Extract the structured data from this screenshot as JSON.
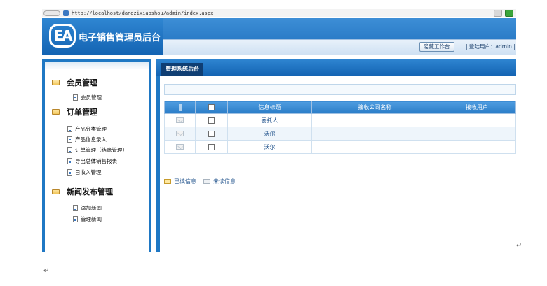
{
  "browser": {
    "url": "http://localhost/dаndzixiaoshou/admin/index.aspx"
  },
  "header": {
    "logo_mark": "EA",
    "title": "电子销售管理员后台",
    "hide_workbench_label": "隐藏工作台",
    "login_info": "| 登陆用户：admin |"
  },
  "sidebar": {
    "groups": [
      {
        "title": "会员管理",
        "items": [
          "会员管理"
        ]
      },
      {
        "title": "订单管理",
        "items": [
          "产品分类管理",
          "产品信息录入",
          "订单管理（结账管理）",
          "导出总体销售报表",
          "日收入管理"
        ]
      },
      {
        "title": "新闻发布管理",
        "items": [
          "添加新闻",
          "管理新闻"
        ]
      }
    ]
  },
  "main": {
    "tab_label": "管理系统后台",
    "table": {
      "headers": [
        "",
        "",
        "信息标题",
        "接收公司名称",
        "接收用户"
      ],
      "rows": [
        {
          "title": "委托人",
          "company": "",
          "user": ""
        },
        {
          "title": "沃尔",
          "company": "",
          "user": ""
        },
        {
          "title": "沃尔",
          "company": "",
          "user": ""
        }
      ]
    },
    "legend": {
      "read": "已读信息",
      "unread": "未读信息"
    }
  },
  "doc_marks": {
    "return_mark_1": "↵",
    "return_mark_2": "↵"
  }
}
